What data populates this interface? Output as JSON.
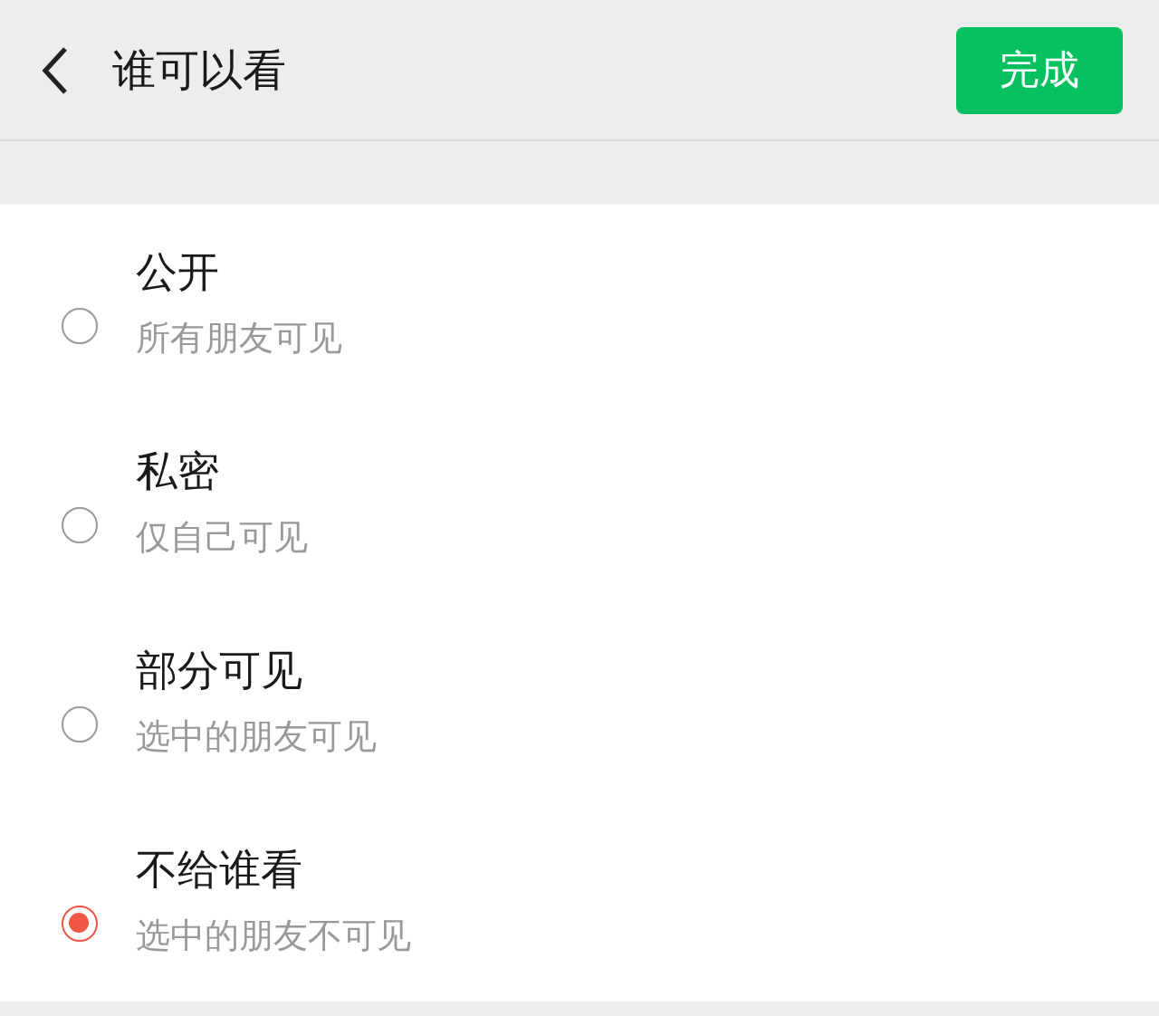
{
  "header": {
    "title": "谁可以看",
    "done_button": "完成"
  },
  "options": [
    {
      "title": "公开",
      "subtitle": "所有朋友可见",
      "selected": false
    },
    {
      "title": "私密",
      "subtitle": "仅自己可见",
      "selected": false
    },
    {
      "title": "部分可见",
      "subtitle": "选中的朋友可见",
      "selected": false
    },
    {
      "title": "不给谁看",
      "subtitle": "选中的朋友不可见",
      "selected": true
    }
  ]
}
